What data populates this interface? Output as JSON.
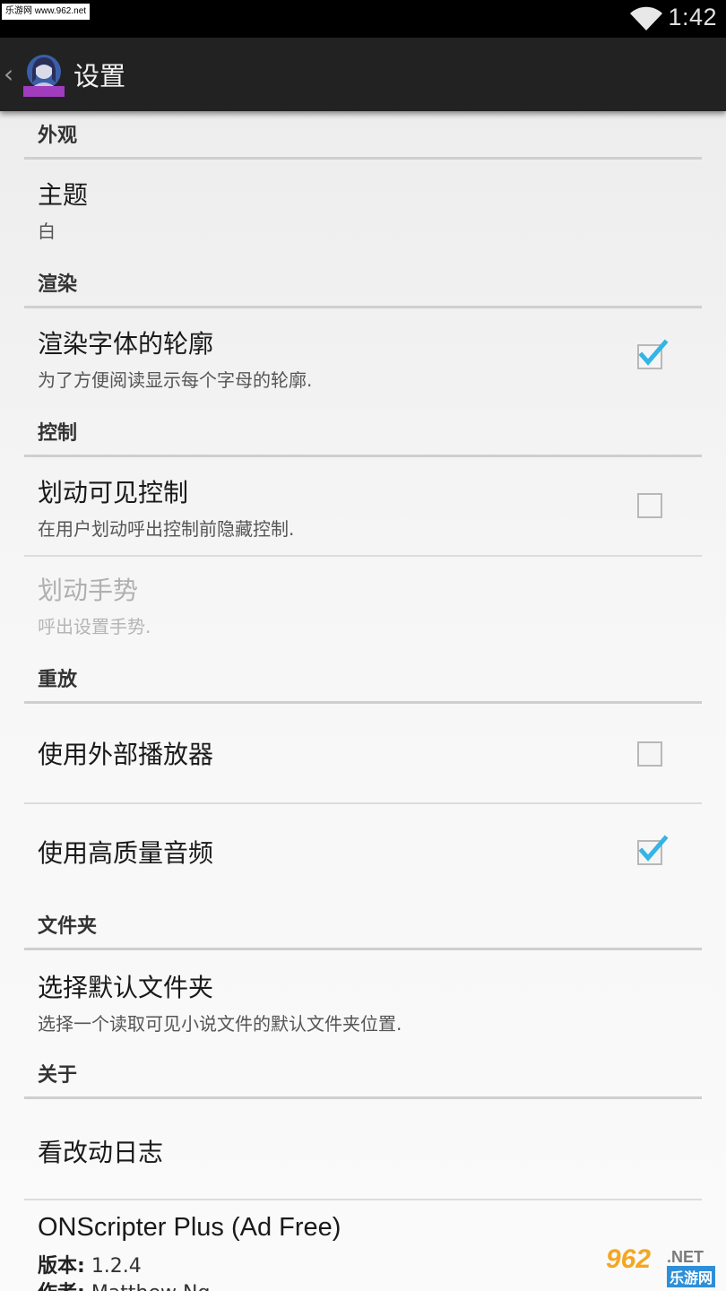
{
  "status_bar": {
    "watermark": "乐游网 www.962.net",
    "time": "1:42"
  },
  "action_bar": {
    "title": "设置"
  },
  "sections": {
    "appearance": {
      "header": "外观"
    },
    "rendering": {
      "header": "渲染"
    },
    "controls": {
      "header": "控制"
    },
    "playback": {
      "header": "重放"
    },
    "folder": {
      "header": "文件夹"
    },
    "about": {
      "header": "关于"
    }
  },
  "prefs": {
    "theme": {
      "title": "主题",
      "summary": "白"
    },
    "render_outline": {
      "title": "渲染字体的轮廓",
      "summary": "为了方便阅读显示每个字母的轮廓.",
      "checked": true
    },
    "swipe_visible": {
      "title": "划动可见控制",
      "summary": "在用户划动呼出控制前隐藏控制.",
      "checked": false
    },
    "swipe_gesture": {
      "title": "划动手势",
      "summary": "呼出设置手势.",
      "enabled": false
    },
    "external_player": {
      "title": "使用外部播放器",
      "checked": false
    },
    "hq_audio": {
      "title": "使用高质量音频",
      "checked": true
    },
    "default_folder": {
      "title": "选择默认文件夹",
      "summary": "选择一个读取可见小说文件的默认文件夹位置."
    },
    "changelog": {
      "title": "看改动日志"
    },
    "app_info": {
      "title": "ONScripter Plus (Ad Free)",
      "version_label": "版本:",
      "version_value": "1.2.4",
      "author_label": "作者:",
      "author_value": "Matthew Ng"
    }
  },
  "watermark_br": {
    "big": "962",
    "net": ".NET",
    "cn": "乐游网"
  },
  "colors": {
    "accent_check": "#33b5e5",
    "action_bar": "#222222",
    "status_bar": "#000000"
  },
  "icons": [
    "wifi-icon",
    "back-chevron-icon",
    "app-avatar-icon",
    "checkmark-icon"
  ]
}
